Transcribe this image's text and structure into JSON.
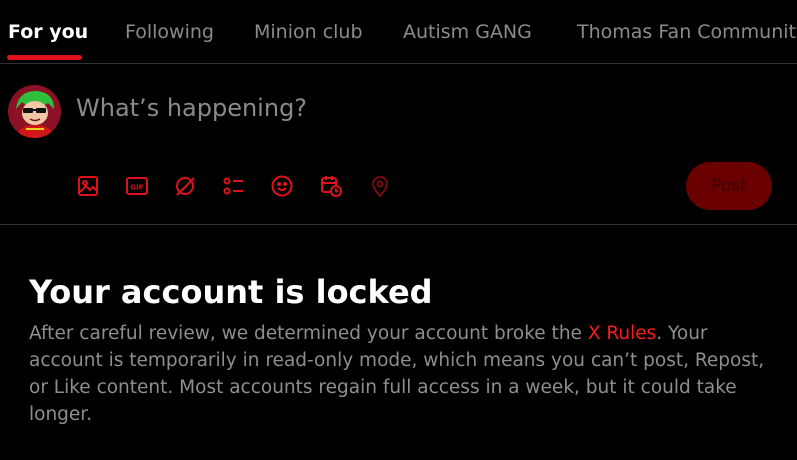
{
  "tabs": [
    {
      "label": "For you",
      "active": true
    },
    {
      "label": "Following",
      "active": false
    },
    {
      "label": "Minion club",
      "active": false
    },
    {
      "label": "Autism GANG",
      "active": false
    },
    {
      "label": "Thomas Fan Community",
      "active": false
    }
  ],
  "composer": {
    "placeholder": "What’s happening?",
    "post_label": "Post",
    "toolbar_icons": [
      "image-icon",
      "gif-icon",
      "grok-icon",
      "poll-icon",
      "emoji-icon",
      "schedule-icon",
      "location-icon"
    ]
  },
  "notice": {
    "title": "Your account is locked",
    "body_before": "After careful review, we determined your account broke the ",
    "rules_link": "X Rules",
    "body_after": ". Your account is temporarily in read-only mode, which means you can’t post, Repost, or Like content. Most accounts regain full access in a week, but it could take longer."
  },
  "colors": {
    "accent": "#e0101c",
    "post_button": "#6a0000",
    "background": "#000000"
  }
}
